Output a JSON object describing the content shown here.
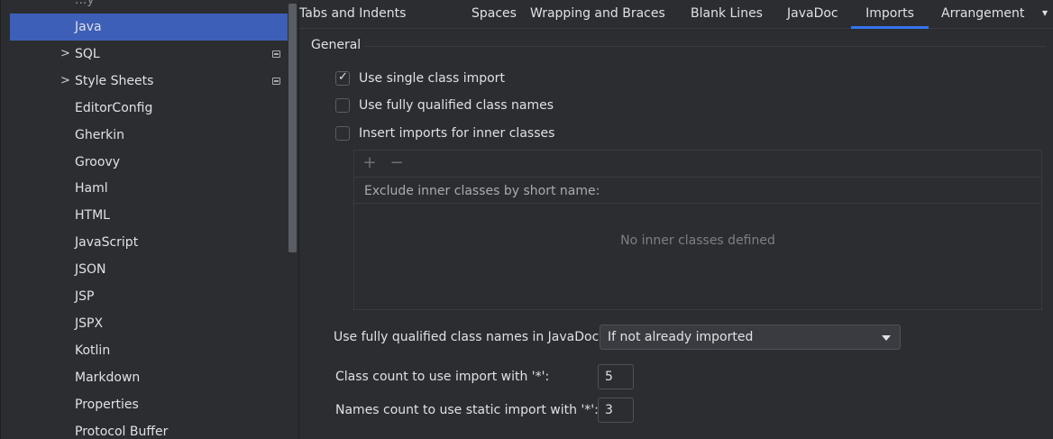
{
  "sidebar": {
    "partial_top": "...y",
    "items": [
      {
        "label": "Java",
        "selected": true,
        "expandable": false,
        "scheme": false
      },
      {
        "label": "SQL",
        "selected": false,
        "expandable": true,
        "scheme": true
      },
      {
        "label": "Style Sheets",
        "selected": false,
        "expandable": true,
        "scheme": true
      },
      {
        "label": "EditorConfig",
        "selected": false,
        "expandable": false,
        "scheme": false
      },
      {
        "label": "Gherkin",
        "selected": false,
        "expandable": false,
        "scheme": false
      },
      {
        "label": "Groovy",
        "selected": false,
        "expandable": false,
        "scheme": false
      },
      {
        "label": "Haml",
        "selected": false,
        "expandable": false,
        "scheme": false
      },
      {
        "label": "HTML",
        "selected": false,
        "expandable": false,
        "scheme": false
      },
      {
        "label": "JavaScript",
        "selected": false,
        "expandable": false,
        "scheme": false
      },
      {
        "label": "JSON",
        "selected": false,
        "expandable": false,
        "scheme": false
      },
      {
        "label": "JSP",
        "selected": false,
        "expandable": false,
        "scheme": false
      },
      {
        "label": "JSPX",
        "selected": false,
        "expandable": false,
        "scheme": false
      },
      {
        "label": "Kotlin",
        "selected": false,
        "expandable": false,
        "scheme": false
      },
      {
        "label": "Markdown",
        "selected": false,
        "expandable": false,
        "scheme": false
      },
      {
        "label": "Properties",
        "selected": false,
        "expandable": false,
        "scheme": false
      },
      {
        "label": "Protocol Buffer",
        "selected": false,
        "expandable": false,
        "scheme": false
      }
    ],
    "expand_glyph": ">"
  },
  "tabs": [
    {
      "label": "Tabs and Indents",
      "active": false
    },
    {
      "label": "Spaces",
      "active": false
    },
    {
      "label": "Wrapping and Braces",
      "active": false
    },
    {
      "label": "Blank Lines",
      "active": false
    },
    {
      "label": "JavaDoc",
      "active": false
    },
    {
      "label": "Imports",
      "active": true
    },
    {
      "label": "Arrangement",
      "active": false
    }
  ],
  "general": {
    "title": "General",
    "checks": [
      {
        "label": "Use single class import",
        "checked": true
      },
      {
        "label": "Use fully qualified class names",
        "checked": false
      },
      {
        "label": "Insert imports for inner classes",
        "checked": false
      }
    ]
  },
  "inner_classes_table": {
    "add_glyph": "+",
    "remove_glyph": "−",
    "header": "Exclude inner classes by short name:",
    "empty_text": "No inner classes defined"
  },
  "javadoc": {
    "label": "Use fully qualified class names in JavaDoc:",
    "value": "If not already imported"
  },
  "class_count": {
    "label": "Class count to use import with '*':",
    "value": "5"
  },
  "names_count": {
    "label": "Names count to use static import with '*':",
    "value": "3"
  },
  "colors": {
    "accent": "#3574f0",
    "selection": "#3d5fb8",
    "background": "#2b2d30"
  }
}
